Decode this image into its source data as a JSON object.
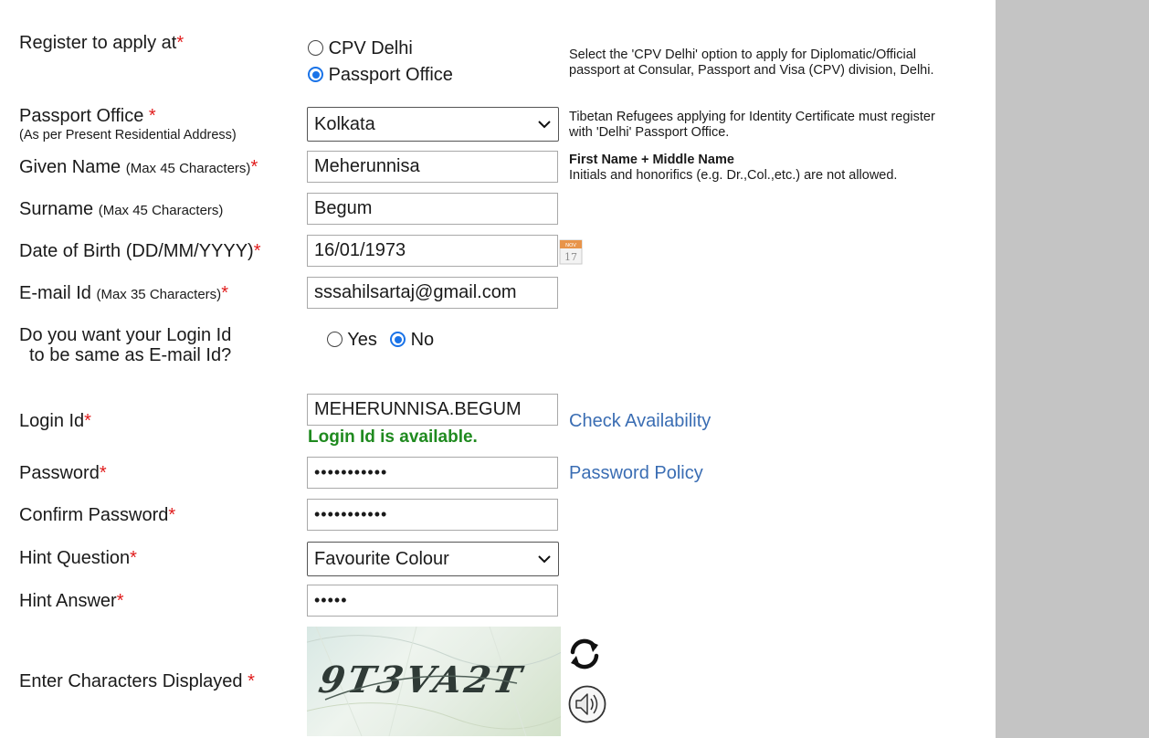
{
  "register": {
    "label": "Register to apply at",
    "options": [
      "CPV Delhi",
      "Passport Office"
    ],
    "selected": "Passport Office",
    "help": "Select the 'CPV Delhi' option to apply for Diplomatic/Official passport at Consular, Passport and Visa (CPV) division, Delhi."
  },
  "passport_office": {
    "label": "Passport Office",
    "sublabel": "(As per Present Residential Address)",
    "value": "Kolkata",
    "help": "Tibetan Refugees applying for Identity Certificate must register with 'Delhi' Passport Office."
  },
  "given_name": {
    "label": "Given Name",
    "hint": "(Max 45 Characters)",
    "value": "Meherunnisa",
    "help_bold": "First Name + Middle Name",
    "help": "Initials and honorifics (e.g. Dr.,Col.,etc.) are not allowed."
  },
  "surname": {
    "label": "Surname",
    "hint": "(Max 45 Characters)",
    "value": "Begum"
  },
  "dob": {
    "label": "Date of Birth (DD/MM/YYYY)",
    "value": "16/01/1973",
    "calendar_month": "NOV",
    "calendar_day": "17"
  },
  "email": {
    "label": "E-mail Id",
    "hint": "(Max 35 Characters)",
    "value": "sssahilsartaj@gmail.com"
  },
  "login_same": {
    "label_line1": "Do you want your Login Id",
    "label_line2": "to be same as E-mail Id?",
    "options": [
      "Yes",
      "No"
    ],
    "selected": "No"
  },
  "login": {
    "label": "Login Id",
    "value": "MEHERUNNISA.BEGUM",
    "status": "Login Id is available.",
    "check_link": "Check Availability"
  },
  "password": {
    "label": "Password",
    "masked": "•••••••••••",
    "policy_link": "Password Policy"
  },
  "confirm_password": {
    "label": "Confirm Password",
    "masked": "•••••••••••"
  },
  "hint_question": {
    "label": "Hint Question",
    "value": "Favourite Colour"
  },
  "hint_answer": {
    "label": "Hint Answer",
    "masked": "•••••"
  },
  "captcha": {
    "label": "Enter Characters Displayed",
    "text": "9T3VA2T"
  },
  "required_mark": "*",
  "colors": {
    "required": "#e01b1b",
    "link": "#3a6db3",
    "success": "#1f8a1f",
    "radio": "#1a73e8",
    "side_panel": "#c4c4c4"
  }
}
